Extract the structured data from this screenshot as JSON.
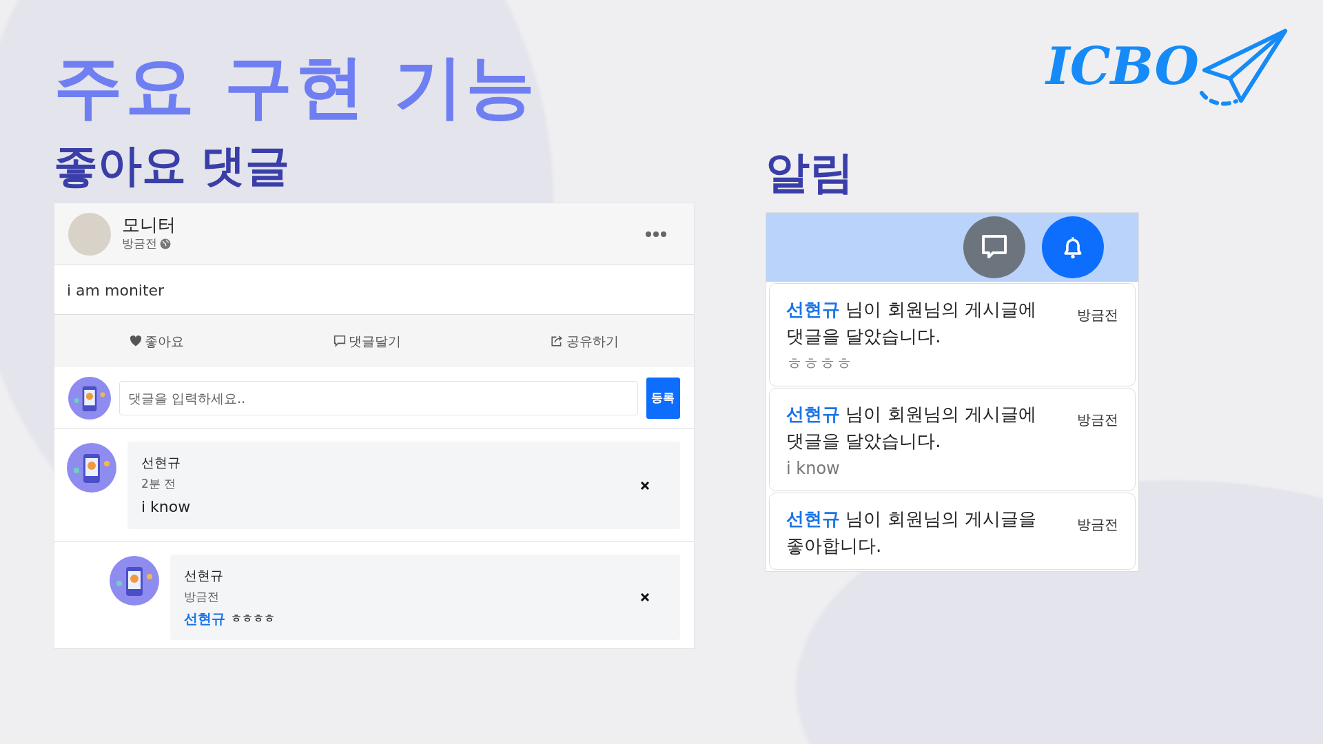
{
  "slide_title": "주요 구현 기능",
  "logo": {
    "text": "ICBO"
  },
  "feed": {
    "heading": "좋아요 댓글",
    "post": {
      "author": "모니터",
      "time": "방금전",
      "body": "i am moniter",
      "actions": [
        {
          "kind": "like",
          "label": "좋아요"
        },
        {
          "kind": "comment",
          "label": "댓글달기"
        },
        {
          "kind": "share",
          "label": "공유하기"
        }
      ],
      "comment_input": {
        "placeholder": "댓글을 입력하세요..",
        "button": "등록"
      },
      "comments": [
        {
          "author": "선현규",
          "time": "2분 전",
          "text": "i know",
          "children": [
            {
              "author": "선현규",
              "time": "방금전",
              "mention": "선현규",
              "text": "ㅎㅎㅎㅎ"
            }
          ]
        }
      ]
    }
  },
  "notifications": {
    "heading": "알림",
    "buttons": [
      {
        "kind": "chat",
        "selected": false
      },
      {
        "kind": "bell",
        "selected": true
      }
    ],
    "items": [
      {
        "author": "선현규",
        "message": "님이 회원님의 게시글에 댓글을 달았습니다.",
        "time": "방금전",
        "preview": "ㅎㅎㅎㅎ"
      },
      {
        "author": "선현규",
        "message": "님이 회원님의 게시글에 댓글을 달았습니다.",
        "time": "방금전",
        "preview": "i know"
      },
      {
        "author": "선현규",
        "message": "님이 회원님의 게시글을 좋아합니다.",
        "time": "방금전"
      }
    ]
  }
}
